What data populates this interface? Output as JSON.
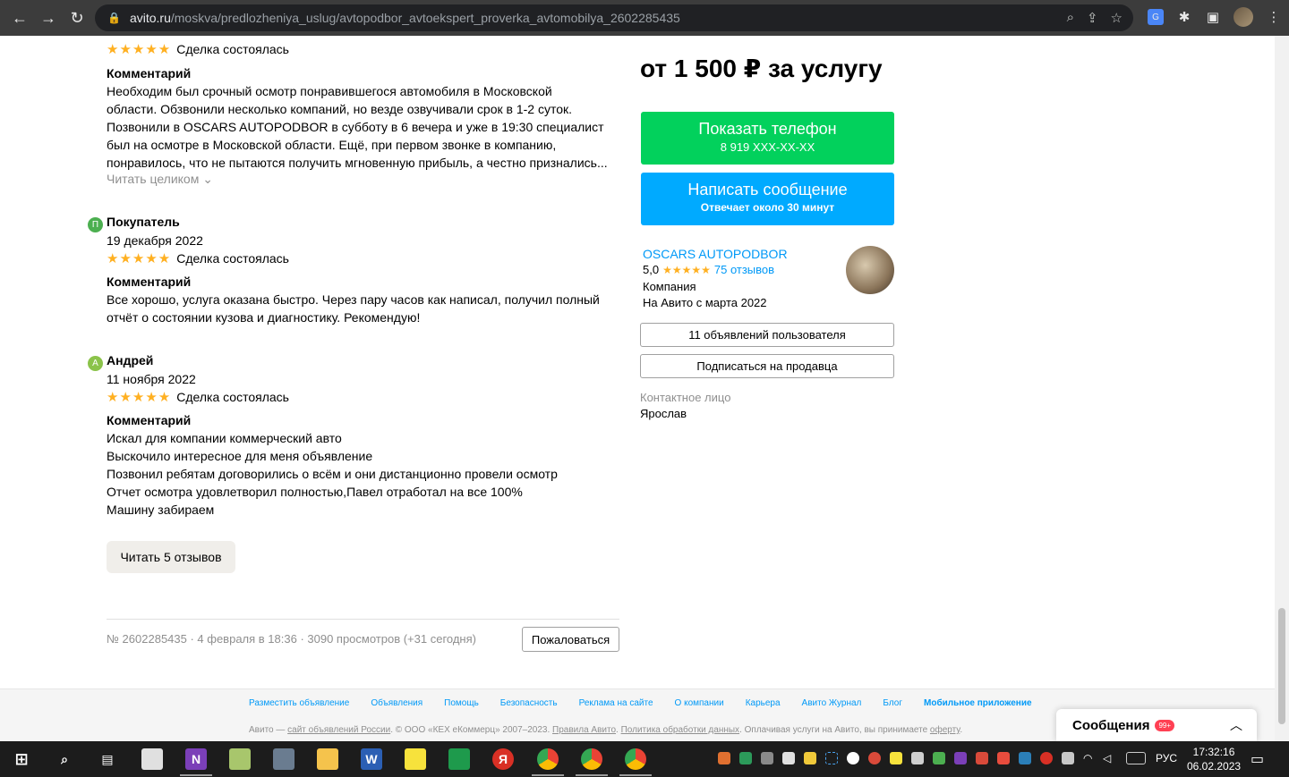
{
  "browser": {
    "url_domain": "avito.ru",
    "url_path": "/moskva/predlozheniya_uslug/avtopodbor_avtoekspert_proverka_avtomobilya_2602285435"
  },
  "reviews": [
    {
      "stars": "★★★★★",
      "deal": "Сделка состоялась",
      "comment_title": "Комментарий",
      "lines": [
        "Необходим был срочный осмотр понравившегося автомобиля в Московской",
        "области. Обзвонили несколько компаний, но везде озвучивали срок в 1-2 суток.",
        "Позвонили в OSCARS AUTOPODBOR в субботу в 6 вечера и уже в 19:30 специалист",
        "был на осмотре в Московской области. Ещё, при первом звонке в компанию,",
        "понравилось, что не пытаются получить мгновенную прибыль, а честно признались..."
      ],
      "read_more": "Читать целиком ⌄"
    },
    {
      "initial": "П",
      "name": "Покупатель",
      "date": "19 декабря 2022",
      "stars": "★★★★★",
      "deal": "Сделка состоялась",
      "comment_title": "Комментарий",
      "lines": [
        "Все хорошо, услуга оказана быстро. Через пару часов как написал, получил полный",
        "отчёт о состоянии кузова и диагностику. Рекомендую!"
      ]
    },
    {
      "initial": "А",
      "name": "Андрей",
      "date": "11 ноября 2022",
      "stars": "★★★★★",
      "deal": "Сделка состоялась",
      "comment_title": "Комментарий",
      "lines": [
        "Искал для компании коммерческий авто",
        "Выскочило интересное для меня объявление",
        "Позвонил ребятам договорились о всём и они дистанционно провели осмотр",
        "Отчет осмотра удовлетворил полностью,Павел отработал на все 100%",
        "Машину забираем"
      ]
    }
  ],
  "read_reviews_button": "Читать 5 отзывов",
  "meta": "№ 2602285435 · 4 февраля в 18:36 · 3090 просмотров (+31 сегодня)",
  "complain_button": "Пожаловаться",
  "sidebar": {
    "price": "от 1 500 ₽ за услугу",
    "phone_button": {
      "label": "Показать телефон",
      "sub": "8 919 XXX-XX-XX"
    },
    "message_button": {
      "label": "Написать сообщение",
      "sub": "Отвечает около 30 минут"
    },
    "seller_name": "OSCARS AUTOPODBOR",
    "rating": "5,0",
    "stars": "★★★★★",
    "reviews_link": "75 отзывов",
    "seller_type": "Компания",
    "since": "На Авито с марта 2022",
    "ads_button": "11 объявлений пользователя",
    "subscribe_button": "Подписаться на продавца",
    "contact_label": "Контактное лицо",
    "contact_name": "Ярослав"
  },
  "footer": {
    "links": [
      "Разместить объявление",
      "Объявления",
      "Помощь",
      "Безопасность",
      "Реклама на сайте",
      "О компании",
      "Карьера",
      "Авито Журнал",
      "Блог",
      "Мобильное приложение"
    ],
    "copy_prefix": "Авито — ",
    "copy_link1": "сайт объявлений России",
    "copy_mid": ". © ООО «КЕХ еКоммерц» 2007–2023. ",
    "copy_link2": "Правила Авито",
    "copy_link3": "Политика обработки данных",
    "copy_mid2": ". Оплачивая услуги на Авито, вы принимаете ",
    "copy_link4": "оферту",
    "copy_end": "."
  },
  "messages": {
    "title": "Сообщения",
    "count": "99+"
  },
  "taskbar": {
    "lang": "РУС",
    "time": "17:32:16",
    "date": "06.02.2023"
  },
  "colors": {
    "green": "#02d15c",
    "blue": "#00aaff",
    "star": "#ffb021",
    "link": "#0099f7"
  }
}
